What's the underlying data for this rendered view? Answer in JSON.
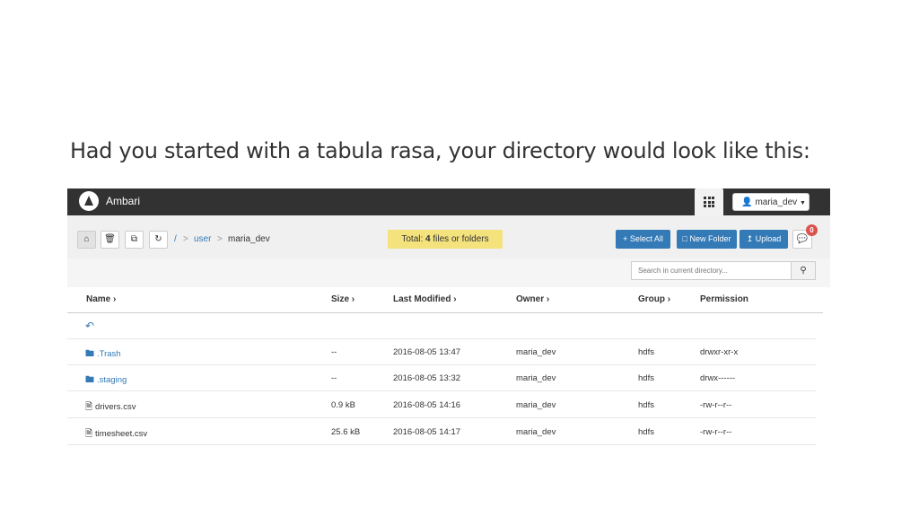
{
  "slide": {
    "heading": "Had you started with a tabula rasa, your directory would look like this:"
  },
  "app": {
    "brand": "Ambari",
    "user": "maria_dev"
  },
  "breadcrumb": {
    "root": "/",
    "items": [
      "user",
      "maria_dev"
    ]
  },
  "summary": {
    "prefix": "Total: ",
    "count": "4",
    "suffix": " files or folders"
  },
  "actions": {
    "select_all": "Select All",
    "new_folder": "New Folder",
    "upload": "Upload",
    "notifications": "0"
  },
  "search": {
    "placeholder": "Search in current directory..."
  },
  "columns": [
    "Name",
    "Size",
    "Last Modified",
    "Owner",
    "Group",
    "Permission"
  ],
  "rows": [
    {
      "name": ".Trash",
      "type": "folder",
      "size": "--",
      "modified": "2016-08-05 13:47",
      "owner": "maria_dev",
      "group": "hdfs",
      "permission": "drwxr-xr-x"
    },
    {
      "name": ".staging",
      "type": "folder",
      "size": "--",
      "modified": "2016-08-05 13:32",
      "owner": "maria_dev",
      "group": "hdfs",
      "permission": "drwx------"
    },
    {
      "name": "drivers.csv",
      "type": "file",
      "size": "0.9 kB",
      "modified": "2016-08-05 14:16",
      "owner": "maria_dev",
      "group": "hdfs",
      "permission": "-rw-r--r--"
    },
    {
      "name": "timesheet.csv",
      "type": "file",
      "size": "25.6 kB",
      "modified": "2016-08-05 14:17",
      "owner": "maria_dev",
      "group": "hdfs",
      "permission": "-rw-r--r--"
    }
  ],
  "colors": {
    "topbar": "#323232",
    "primary": "#337ab7",
    "highlight": "#f4e27d",
    "badge": "#d9534f"
  }
}
